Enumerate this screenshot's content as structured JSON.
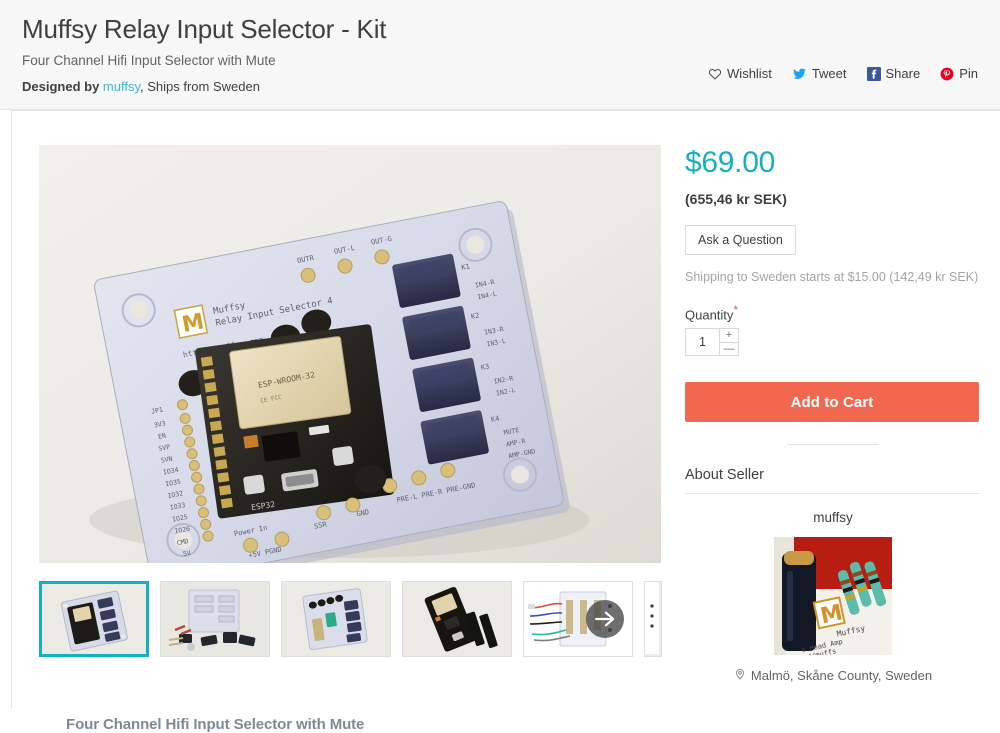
{
  "header": {
    "title": "Muffsy Relay Input Selector - Kit",
    "subtitle": "Four Channel Hifi Input Selector with Mute",
    "designed_by_label": "Designed by",
    "designer_name": "muffsy",
    "ships_from": ", Ships from Sweden",
    "social": [
      {
        "label": "Wishlist",
        "icon": "heart-icon",
        "color": "#3c4043"
      },
      {
        "label": "Tweet",
        "icon": "twitter-icon",
        "color": "#1da1f2"
      },
      {
        "label": "Share",
        "icon": "facebook-icon",
        "color": "#3b5998"
      },
      {
        "label": "Pin",
        "icon": "pinterest-icon",
        "color": "#e60023"
      }
    ]
  },
  "gallery": {
    "caption": "Four Channel Hifi Input Selector with Mute",
    "main_image_alt": "Muffsy Relay Input Selector PCB with ESP32 module and blue relays",
    "next_arrow_icon": "arrow-right-icon",
    "thumbnails": [
      {
        "alt": "Assembled relay input selector board",
        "selected": true
      },
      {
        "alt": "Kit parts laid out with bare PCB"
      },
      {
        "alt": "Board with green capacitor and relays"
      },
      {
        "alt": "ESP32 module with black header strips"
      },
      {
        "alt": "Wiring diagram with colored wires"
      }
    ]
  },
  "purchase": {
    "price": "$69.00",
    "price_local": "(655,46 kr SEK)",
    "ask_question_label": "Ask a Question",
    "shipping_note": "Shipping to Sweden starts at $15.00 (142,49 kr SEK)",
    "quantity_label": "Quantity",
    "quantity_required_mark": "*",
    "quantity_value": "1",
    "stepper_up": "+",
    "stepper_down": "—",
    "add_to_cart_label": "Add to Cart",
    "accent_price_color": "#17b0bd",
    "cart_button_color": "#f2674f"
  },
  "seller": {
    "section_title": "About Seller",
    "name": "muffsy",
    "avatar_alt": "Muffsy branded PCB with capacitor and resistors",
    "location": "Malmö, Skåne County, Sweden",
    "location_icon": "map-pin-icon"
  }
}
